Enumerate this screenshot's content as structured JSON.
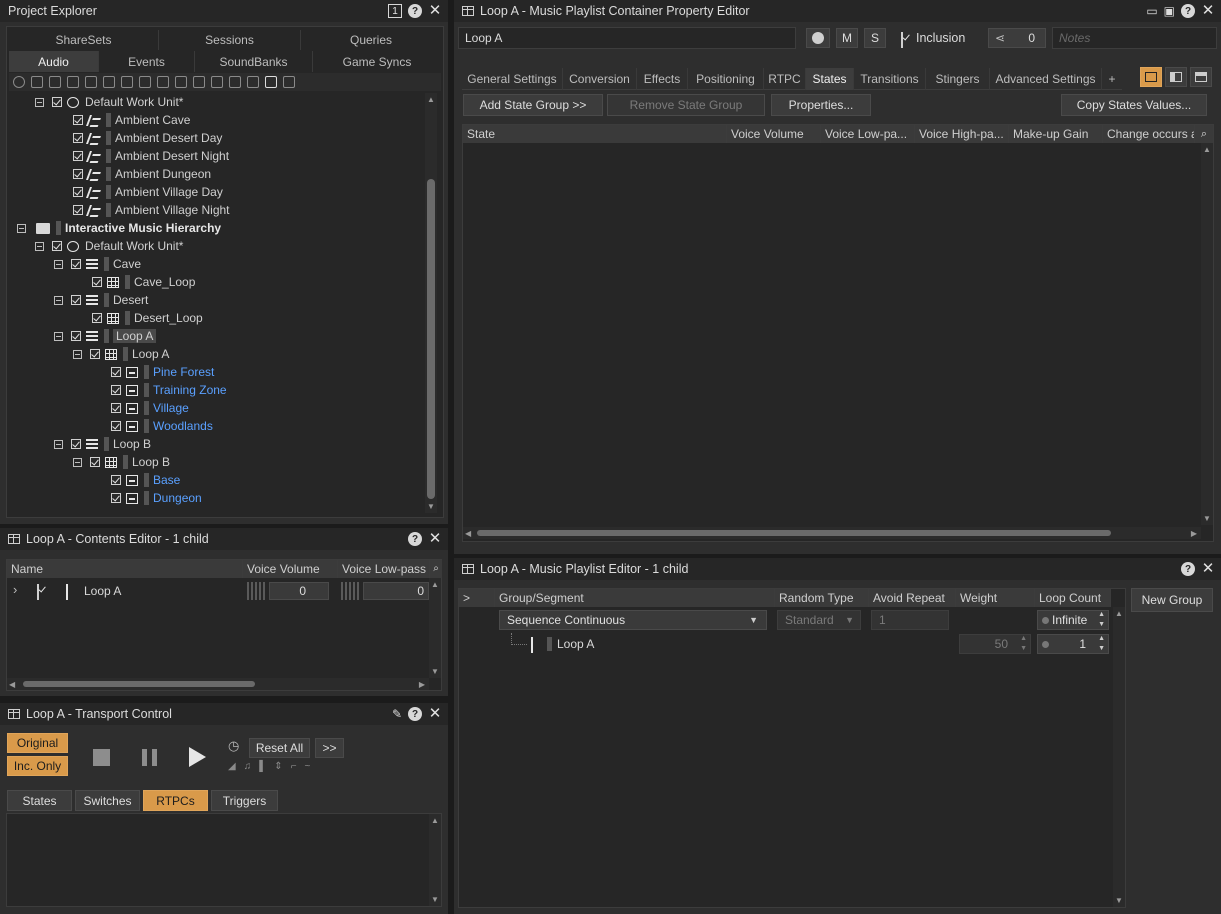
{
  "project_explorer": {
    "title": "Project Explorer",
    "tabs_top": [
      "ShareSets",
      "Sessions",
      "Queries"
    ],
    "tabs_bottom": [
      "Audio",
      "Events",
      "SoundBanks",
      "Game Syncs"
    ],
    "tree": [
      {
        "label": "Default Work Unit*",
        "icon": "work-unit-icon",
        "style": "normal"
      },
      {
        "label": "Ambient Cave",
        "icon": "random-container-icon",
        "style": "normal"
      },
      {
        "label": "Ambient Desert Day",
        "icon": "random-container-icon",
        "style": "normal"
      },
      {
        "label": "Ambient Desert Night",
        "icon": "random-container-icon",
        "style": "normal"
      },
      {
        "label": "Ambient Dungeon",
        "icon": "random-container-icon",
        "style": "normal"
      },
      {
        "label": "Ambient Village Day",
        "icon": "random-container-icon",
        "style": "normal"
      },
      {
        "label": "Ambient Village Night",
        "icon": "random-container-icon",
        "style": "normal"
      },
      {
        "label": "Interactive Music Hierarchy",
        "icon": "folder-icon",
        "style": "bold"
      },
      {
        "label": "Default Work Unit*",
        "icon": "work-unit-icon",
        "style": "normal"
      },
      {
        "label": "Cave",
        "icon": "switch-container-icon",
        "style": "normal"
      },
      {
        "label": "Cave_Loop",
        "icon": "playlist-container-icon",
        "style": "normal"
      },
      {
        "label": "Desert",
        "icon": "switch-container-icon",
        "style": "normal"
      },
      {
        "label": "Desert_Loop",
        "icon": "playlist-container-icon",
        "style": "normal"
      },
      {
        "label": "Loop A",
        "icon": "switch-container-icon",
        "style": "selected"
      },
      {
        "label": "Loop A",
        "icon": "playlist-container-icon",
        "style": "normal"
      },
      {
        "label": "Pine Forest",
        "icon": "segment-icon",
        "style": "blue"
      },
      {
        "label": "Training Zone",
        "icon": "segment-icon",
        "style": "blue"
      },
      {
        "label": "Village",
        "icon": "segment-icon",
        "style": "blue"
      },
      {
        "label": "Woodlands",
        "icon": "segment-icon",
        "style": "blue"
      },
      {
        "label": "Loop B",
        "icon": "switch-container-icon",
        "style": "normal"
      },
      {
        "label": "Loop B",
        "icon": "playlist-container-icon",
        "style": "normal"
      },
      {
        "label": "Base",
        "icon": "segment-icon",
        "style": "blue"
      },
      {
        "label": "Dungeon",
        "icon": "segment-icon",
        "style": "blue"
      }
    ]
  },
  "contents_editor": {
    "title": "Loop A - Contents Editor - 1 child",
    "columns": [
      "Name",
      "Voice Volume",
      "Voice Low-pass F"
    ],
    "row": {
      "name": "Loop A",
      "volume": "0",
      "lowpass": "0"
    }
  },
  "transport": {
    "title": "Loop A - Transport Control",
    "original": "Original",
    "inc_only": "Inc. Only",
    "reset_all": "Reset All",
    "more": ">>",
    "tabs": [
      "States",
      "Switches",
      "RTPCs",
      "Triggers"
    ]
  },
  "property_editor": {
    "title": "Loop A - Music Playlist Container Property Editor",
    "name_value": "Loop A",
    "m_label": "M",
    "s_label": "S",
    "inclusion_label": "Inclusion",
    "share_count": "0",
    "notes_placeholder": "Notes",
    "tabs": [
      "General Settings",
      "Conversion",
      "Effects",
      "Positioning",
      "RTPC",
      "States",
      "Transitions",
      "Stingers",
      "Advanced Settings",
      "+"
    ],
    "add_state_group": "Add State Group >>",
    "remove_state_group": "Remove State Group",
    "properties": "Properties...",
    "copy_states": "Copy States Values...",
    "columns": [
      "State",
      "Voice Volume",
      "Voice Low-pa...",
      "Voice High-pa...",
      "Make-up Gain",
      "Change occurs a"
    ]
  },
  "playlist_editor": {
    "title": "Loop A - Music Playlist Editor - 1 child",
    "columns": [
      ">",
      "Group/Segment",
      "Random Type",
      "Avoid Repeat",
      "Weight",
      "Loop Count"
    ],
    "group_row": {
      "name": "Sequence Continuous",
      "random_type": "Standard",
      "avoid_repeat": "1",
      "loop_count": "Infinite"
    },
    "child_row": {
      "name": "Loop A",
      "weight": "50",
      "loop_count": "1"
    },
    "new_group": "New Group"
  },
  "colors": {
    "accent_orange": "#d99a4a",
    "link_blue": "#5aa0ff",
    "panel_bg": "#2e2e2e"
  }
}
